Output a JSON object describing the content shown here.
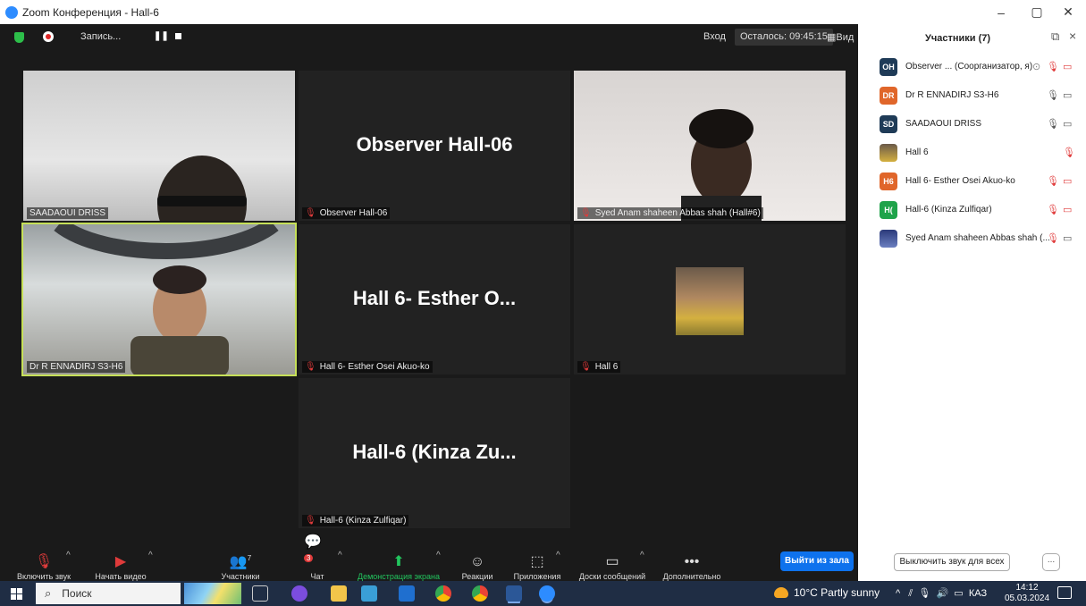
{
  "window": {
    "title": "Zoom Конференция - Hall-6",
    "controls": [
      "minimize",
      "maximize",
      "close"
    ]
  },
  "topbar": {
    "recording_label": "Запись...",
    "login_label": "Вход",
    "remaining": "Осталось: 09:45:15",
    "view_label": "Вид"
  },
  "tiles": [
    {
      "label": "SAADAOUI DRISS",
      "big_name": "",
      "muted_icon": false
    },
    {
      "label": "Observer Hall-06",
      "big_name": "Observer Hall-06",
      "muted_icon": true
    },
    {
      "label": "Syed Anam shaheen Abbas shah (Hall#6)",
      "big_name": "",
      "muted_icon": true
    },
    {
      "label": "Dr R ENNADIRJ S3-H6",
      "big_name": "",
      "muted_icon": false
    },
    {
      "label": "Hall 6- Esther Osei Akuo-ko",
      "big_name": "Hall 6- Esther O...",
      "muted_icon": true
    },
    {
      "label": "Hall 6",
      "big_name": "",
      "muted_icon": true
    },
    {
      "label": "Hall-6 (Kinza Zulfiqar)",
      "big_name": "Hall-6 (Kinza Zu...",
      "muted_icon": true
    }
  ],
  "toolbar": {
    "unmute": "Включить звук",
    "start_video": "Начать видео",
    "participants": "Участники",
    "participants_count": "7",
    "chat": "Чат",
    "chat_badge": "3",
    "share_screen": "Демонстрация экрана",
    "reactions": "Реакции",
    "apps": "Приложения",
    "whiteboards": "Доски сообщений",
    "more": "Дополнительно",
    "leave": "Выйти из зала"
  },
  "panel": {
    "title": "Участники (7)",
    "participants": [
      {
        "initials": "OH",
        "color": "#1f3b57",
        "name": "Observer ... (Соорганизатор, я)",
        "mic": "muted",
        "video": "off"
      },
      {
        "initials": "DR",
        "color": "#e0662a",
        "name": "Dr R ENNADIRJ S3-H6",
        "mic": "on",
        "video": "on"
      },
      {
        "initials": "SD",
        "color": "#1f3b57",
        "name": "SAADAOUI DRISS",
        "mic": "on",
        "video": "on"
      },
      {
        "initials": "",
        "color": "#8a6d5a",
        "name": "Hall 6",
        "mic": "muted",
        "video": "none"
      },
      {
        "initials": "H6",
        "color": "#e0662a",
        "name": "Hall 6- Esther Osei Akuo-ko",
        "mic": "muted",
        "video": "off"
      },
      {
        "initials": "H(",
        "color": "#1fa34a",
        "name": "Hall-6 (Kinza Zulfiqar)",
        "mic": "muted",
        "video": "off"
      },
      {
        "initials": "",
        "color": "#3b4a8a",
        "name": "Syed Anam shaheen Abbas shah (...",
        "mic": "muted",
        "video": "on"
      }
    ],
    "mute_all": "Выключить звук для всех",
    "more": "..."
  },
  "taskbar": {
    "search_label": "Поиск",
    "weather": "10°C  Partly sunny",
    "lang": "КАЗ",
    "time": "14:12",
    "date": "05.03.2024"
  }
}
